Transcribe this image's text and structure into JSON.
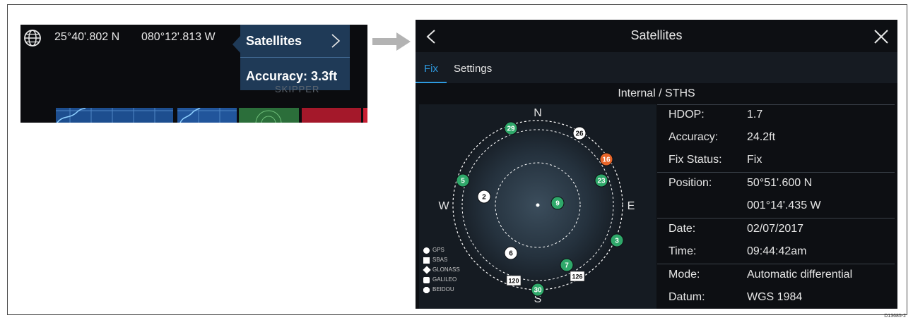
{
  "left": {
    "latitude": "25°40'.802 N",
    "longitude": "080°12'.813 W",
    "popup": {
      "title": "Satellites",
      "accuracy": "Accuracy: 3.3ft"
    },
    "ghost_label": "SKIPPER"
  },
  "dialog": {
    "title": "Satellites",
    "tabs": [
      {
        "label": "Fix",
        "active": true
      },
      {
        "label": "Settings",
        "active": false
      }
    ],
    "source": "Internal / STHS",
    "compass": {
      "n": "N",
      "s": "S",
      "e": "E",
      "w": "W"
    },
    "satellites": [
      {
        "id": "29",
        "type": "gps",
        "color": "#2fa86a"
      },
      {
        "id": "26",
        "type": "gps",
        "color": "#ffffff"
      },
      {
        "id": "16",
        "type": "gps",
        "color": "#e8662a"
      },
      {
        "id": "23",
        "type": "gps",
        "color": "#2fa86a"
      },
      {
        "id": "5",
        "type": "gps",
        "color": "#2fa86a"
      },
      {
        "id": "2",
        "type": "gps",
        "color": "#ffffff"
      },
      {
        "id": "9",
        "type": "gps",
        "color": "#2fa86a"
      },
      {
        "id": "3",
        "type": "gps",
        "color": "#2fa86a"
      },
      {
        "id": "6",
        "type": "gps",
        "color": "#ffffff"
      },
      {
        "id": "7",
        "type": "gps",
        "color": "#2fa86a"
      },
      {
        "id": "30",
        "type": "gps",
        "color": "#2fa86a"
      },
      {
        "id": "120",
        "type": "sbas",
        "color": "#ffffff"
      },
      {
        "id": "126",
        "type": "sbas",
        "color": "#ffffff"
      }
    ],
    "legend": [
      {
        "label": "GPS",
        "shape": "circle"
      },
      {
        "label": "SBAS",
        "shape": "square"
      },
      {
        "label": "GLONASS",
        "shape": "diamond"
      },
      {
        "label": "GALILEO",
        "shape": "rounded"
      },
      {
        "label": "BEIDOU",
        "shape": "octa"
      }
    ],
    "info": {
      "hdop_label": "HDOP:",
      "hdop": "1.7",
      "accuracy_label": "Accuracy:",
      "accuracy": "24.2ft",
      "fix_status_label": "Fix Status:",
      "fix_status": "Fix",
      "position_label": "Position:",
      "lat": "50°51'.600 N",
      "lon": "001°14'.435 W",
      "date_label": "Date:",
      "date": "02/07/2017",
      "time_label": "Time:",
      "time": "09:44:42am",
      "mode_label": "Mode:",
      "mode": "Automatic differential",
      "datum_label": "Datum:",
      "datum": "WGS 1984"
    }
  },
  "figure_id": "D13685-2",
  "colors": {
    "accent": "#2e9ae0",
    "popup_bg": "#1f3a57",
    "panel_bg": "#0d0f13"
  }
}
